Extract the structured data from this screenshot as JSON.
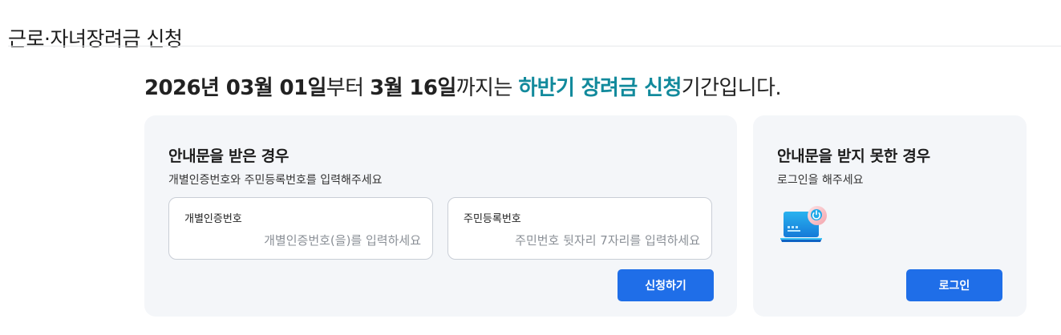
{
  "page": {
    "title": "근로·자녀장려금 신청"
  },
  "notice": {
    "start_date": "2026년 03월 01일",
    "from": "부터 ",
    "end_date": "3월 16일",
    "until": "까지는 ",
    "period_name": "하반기 장려금 신청",
    "suffix": "기간입니다."
  },
  "received_card": {
    "title": "안내문을 받은 경우",
    "subtitle": "개별인증번호와 주민등록번호를 입력해주세요",
    "auth_field": {
      "label": "개별인증번호",
      "value": "",
      "placeholder": "개별인증번호(을)를 입력하세요"
    },
    "rrn_field": {
      "label": "주민등록번호",
      "value": "",
      "placeholder": "주민번호 뒷자리 7자리를 입력하세요"
    },
    "apply_button": "신청하기"
  },
  "not_received_card": {
    "title": "안내문을 받지 못한 경우",
    "subtitle": "로그인을 해주세요",
    "login_button": "로그인",
    "icon": "laptop-power-icon"
  },
  "colors": {
    "accent_teal": "#128a9c",
    "primary_blue": "#1f6ee8",
    "card_bg": "#f4f6f9"
  }
}
